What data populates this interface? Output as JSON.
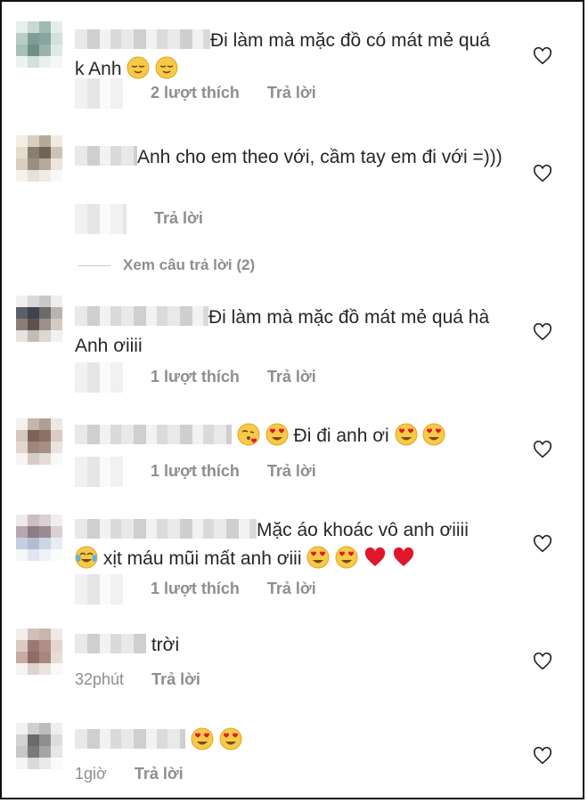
{
  "comments": [
    {
      "text": "Đi làm mà mặc đồ có mát mẻ quá k Anh",
      "emojis": [
        "relieved",
        "relieved"
      ],
      "likes": "2 lượt thích",
      "reply": "Trả lời"
    },
    {
      "text": "Anh cho em theo với, cầm tay em đi với =)))",
      "emojis": [],
      "likes": "",
      "reply": "Trả lời"
    },
    {
      "text": "Đi làm mà mặc đồ mát mẻ quá hà Anh ơiiii",
      "emojis": [],
      "likes": "1 lượt thích",
      "reply": "Trả lời"
    },
    {
      "text_after": "Đi đi anh ơi",
      "likes": "1 lượt thích",
      "reply": "Trả lời"
    },
    {
      "line1": "Mặc áo khoác vô anh ơiiii",
      "line2": "xịt máu mũi mất anh ơiii",
      "likes": "1 lượt thích",
      "reply": "Trả lời"
    },
    {
      "text": "trời",
      "time": "32phút",
      "reply": "Trả lời"
    },
    {
      "time": "1giờ",
      "reply": "Trả lời"
    }
  ],
  "view_replies": "Xem câu trả lời (2)",
  "icons": {
    "like": "heart-outline-icon"
  },
  "colors": {
    "text": "#262626",
    "meta": "#8e8e8e",
    "heart_red": "#e0162b"
  }
}
